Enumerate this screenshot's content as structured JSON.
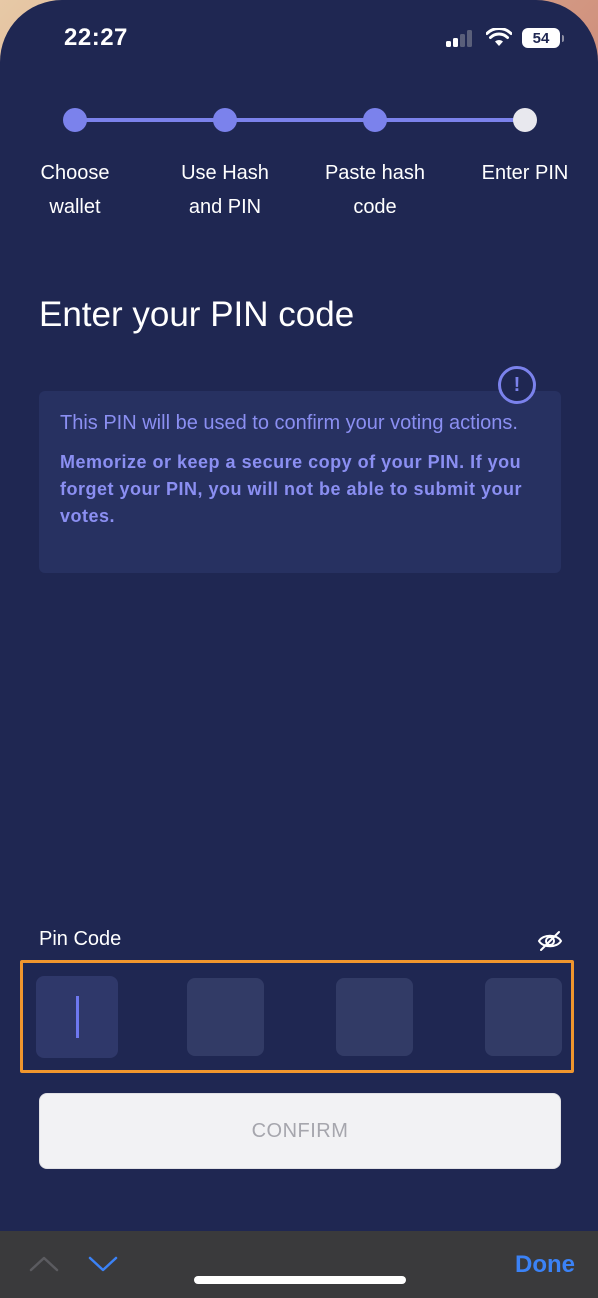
{
  "status_bar": {
    "time": "22:27",
    "battery": "54",
    "icons": [
      "signal-icon",
      "wifi-icon",
      "battery-icon"
    ]
  },
  "stepper": {
    "steps": [
      {
        "label_line1": "Choose",
        "label_line2": "wallet",
        "state": "done"
      },
      {
        "label_line1": "Use Hash",
        "label_line2": "and PIN",
        "state": "done"
      },
      {
        "label_line1": "Paste hash",
        "label_line2": "code",
        "state": "done"
      },
      {
        "label_line1": "Enter PIN",
        "label_line2": "",
        "state": "current"
      }
    ]
  },
  "page": {
    "title": "Enter your PIN code"
  },
  "info": {
    "icon": "exclamation-icon",
    "icon_glyph": "!",
    "text1": "This PIN will be used to confirm your voting actions.",
    "text2": "Memorize or keep a secure copy of your PIN. If you forget your PIN, you will not be able to submit your votes."
  },
  "pin": {
    "label": "Pin Code",
    "toggle_icon": "eye-slash-icon",
    "digits": [
      "",
      "",
      "",
      ""
    ]
  },
  "confirm": {
    "label": "CONFIRM"
  },
  "keyboard_bar": {
    "prev_icon": "chevron-up-icon",
    "next_icon": "chevron-down-icon",
    "done_label": "Done"
  },
  "colors": {
    "background": "#1f2752",
    "accent": "#7b82ec",
    "highlight": "#f0962e",
    "done": "#3b82f6"
  }
}
